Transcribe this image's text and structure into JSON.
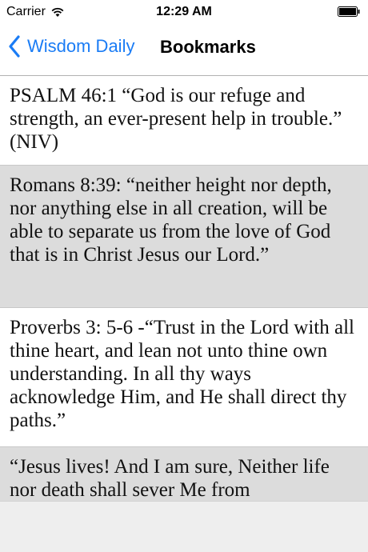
{
  "status_bar": {
    "carrier": "Carrier",
    "time": "12:29 AM",
    "wifi_icon": "wifi-icon",
    "battery_icon": "battery-icon"
  },
  "nav": {
    "back_label": "Wisdom Daily",
    "title": "Bookmarks",
    "back_icon": "chevron-left-icon"
  },
  "colors": {
    "accent": "#1a7cf5",
    "row_shade": "#dcdcdc"
  },
  "bookmarks": [
    {
      "text": "PSALM 46:1 “God is our refuge and strength, an ever-present help in trouble.” (NIV)"
    },
    {
      "text": "Romans 8:39: “neither height nor depth, nor anything else in all creation, will be able to separate us from the love of God that is in Christ Jesus our Lord.”"
    },
    {
      "text": "Proverbs 3: 5-6 -“Trust in the Lord with all thine heart, and lean not unto thine own understanding. In all thy ways acknowledge Him, and He shall direct thy paths.”"
    },
    {
      "text": "“Jesus lives! And I am sure, Neither life nor death shall sever Me from"
    }
  ]
}
